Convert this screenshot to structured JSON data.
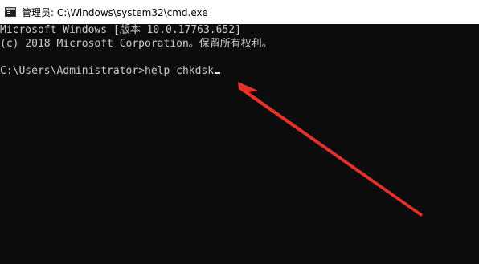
{
  "window": {
    "title": "管理员: C:\\Windows\\system32\\cmd.exe",
    "icon": "cmd-icon"
  },
  "console": {
    "lines": [
      "Microsoft Windows [版本 10.0.17763.652]",
      "(c) 2018 Microsoft Corporation。保留所有权利。",
      "",
      "C:\\Users\\Administrator>help chkdsk"
    ]
  },
  "annotation": {
    "arrow_color": "#e8302a",
    "icon": "red-arrow-annotation"
  }
}
